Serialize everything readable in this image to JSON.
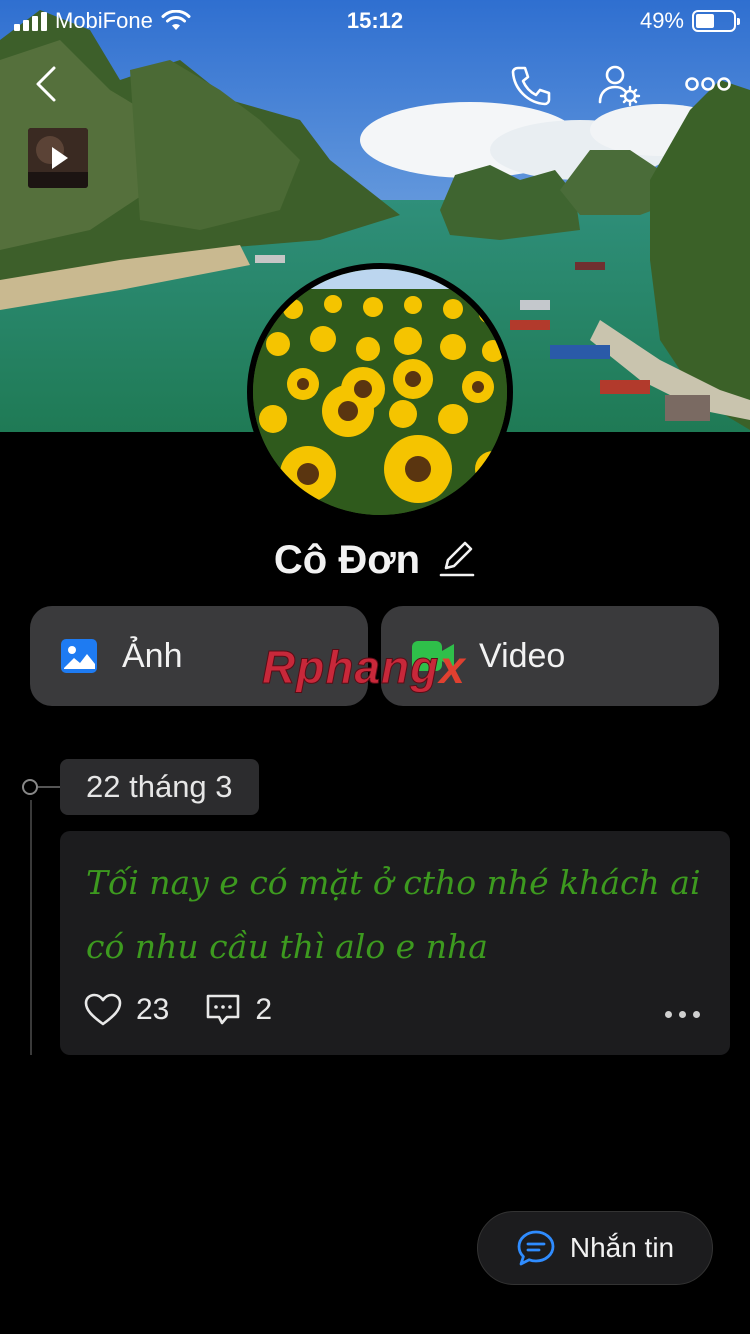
{
  "status_bar": {
    "carrier": "MobiFone",
    "time": "15:12",
    "battery": "49%",
    "battery_level": 0.49
  },
  "header": {
    "icons": [
      "back-icon",
      "phone-icon",
      "user-settings-icon",
      "more-icon"
    ]
  },
  "profile": {
    "name": "Cô Đơn"
  },
  "media_buttons": {
    "photos_label": "Ảnh",
    "video_label": "Video",
    "photos_icon_color": "#1e7bf2",
    "video_icon_color": "#2fbf4a"
  },
  "watermark": {
    "text_a": "Rphang",
    "text_b": "x"
  },
  "timeline": {
    "date": "22 tháng 3",
    "post": {
      "text": "Tối nay e có mặt ở ctho nhé khách ai có nhu cầu thì alo e nha",
      "text_color": "#3d9a1f",
      "likes": "23",
      "comments": "2"
    }
  },
  "message_button": {
    "label": "Nhắn tin",
    "icon_color": "#2f8cff"
  }
}
